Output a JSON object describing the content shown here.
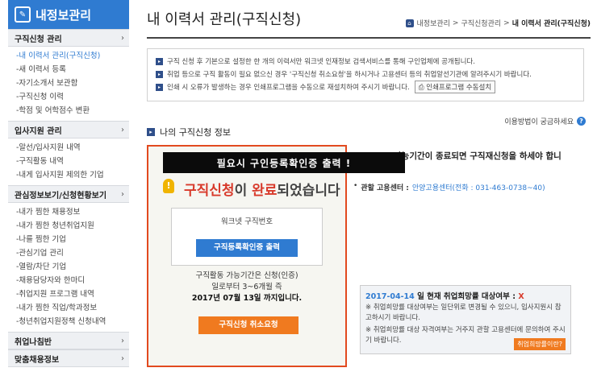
{
  "sidebar": {
    "title": "내정보관리",
    "sections": [
      {
        "label": "구직신청 관리",
        "items": [
          {
            "label": "-내 이력서 관리(구직신청)",
            "active": true
          },
          {
            "label": "-새 이력서 등록"
          },
          {
            "label": "-자기소개서 보관함"
          },
          {
            "label": "-구직신청 이력"
          },
          {
            "label": "-학점 및 어학점수 변환"
          }
        ]
      },
      {
        "label": "입사지원 관리",
        "items": [
          {
            "label": "-알선/입사지원 내역"
          },
          {
            "label": "-구직활동 내역"
          },
          {
            "label": "-내게 입사지원 제의한 기업"
          }
        ]
      },
      {
        "label": "관심정보보기/신청현황보기",
        "items": [
          {
            "label": "-내가 찜한 채용정보"
          },
          {
            "label": "-내가 찜한 청년취업지원"
          },
          {
            "label": "-나를 찜한 기업"
          },
          {
            "label": "-관심기업 관리"
          },
          {
            "label": "-열람/차단 기업"
          },
          {
            "label": "-채용담당자와 한마디"
          },
          {
            "label": "-취업지원 프로그램 내역"
          },
          {
            "label": "-내가 찜한 직업/학과정보"
          },
          {
            "label": "-청년취업지원정책 신청내역"
          }
        ]
      },
      {
        "label": "취업나침반",
        "items": []
      },
      {
        "label": "맞춤채용정보",
        "items": []
      }
    ]
  },
  "main": {
    "title": "내 이력서 관리(구직신청)",
    "breadcrumb": {
      "p1": "내정보관리",
      "sep": ">",
      "p2": "구직신청관리",
      "current": "내 이력서 관리(구직신청)"
    },
    "notices": [
      "구직 신청 후 기본으로 설정한 한 개의 이력서만 워크넷 인재정보 검색서비스를 통해 구인업체에 공개됩니다.",
      "취업 등으로 구직 활동이 필요 없으신 경우 '구직신청 취소요청'을 하시거나 고용센터 등의 취업알선기관에 알려주시기 바랍니다.",
      "인쇄 시 오류가 발생하는 경우 인쇄프로그램을 수동으로 재설치하여 주시기 바랍니다."
    ],
    "print_setup_button": "인쇄프로그램 수동설치",
    "help_text": "이용방법이 궁금하세요",
    "section_title": "나의 구직신청 정보",
    "stamp": "필요시 구인등록확인증 출력 !",
    "complete": {
      "a": "구직신청",
      "b": "이 ",
      "c": "완료",
      "d": "되었습니다"
    },
    "worknet_label": "워크넷 구직번호",
    "print_cert_button": "구직등록확인증 출력",
    "period_line1": "구직활동 가능기간은 신청(인증)",
    "period_line2": "일로부터 3~6개월 즉",
    "period_line3": "2017년 07월 13일 까지입니다.",
    "cancel_button": "구직신청 취소요청",
    "right_text": "가능기간이 종료되면 구직재신청을 하세야 합니",
    "office_label": "관할 고용센터 :",
    "office_value": "안양고용센터(전화 : 031-463-0738~40)",
    "hope_box": {
      "date": "2017-04-14",
      "tail": " 일 현재 취업희망률 대상여부 : ",
      "mark": "X",
      "p1": "※ 취업희망률 대상여부는 일단위로 변경될 수 있으니, 입사지원시 참고하시기 바랍니다.",
      "p2": "※ 취업희망률 대상 자격여부는 거주지 관할 고용센터에 문의하여 주시기 바랍니다.",
      "button": "취업희망률이란?"
    }
  }
}
